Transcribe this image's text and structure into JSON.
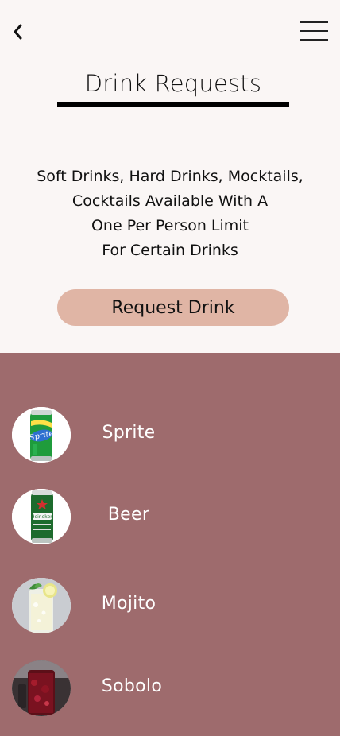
{
  "header": {
    "back_icon": "chevron-left-icon",
    "menu_icon": "hamburger-menu-icon",
    "title": "Drink Requests"
  },
  "description": {
    "lines": [
      "Soft Drinks, Hard Drinks, Mocktails,",
      "Cocktails Available With A",
      "One Per Person Limit",
      "For Certain Drinks"
    ]
  },
  "request_button": {
    "label": "Request Drink"
  },
  "drinks": [
    {
      "name": "Sprite",
      "image": "sprite-can"
    },
    {
      "name": "Beer",
      "image": "heineken-can"
    },
    {
      "name": "Mojito",
      "image": "mojito-glass"
    },
    {
      "name": "Sobolo",
      "image": "sobolo-glass"
    }
  ],
  "colors": {
    "background": "#faf6f5",
    "list_background": "#9e6b6d",
    "button": "#e0b5a5"
  }
}
